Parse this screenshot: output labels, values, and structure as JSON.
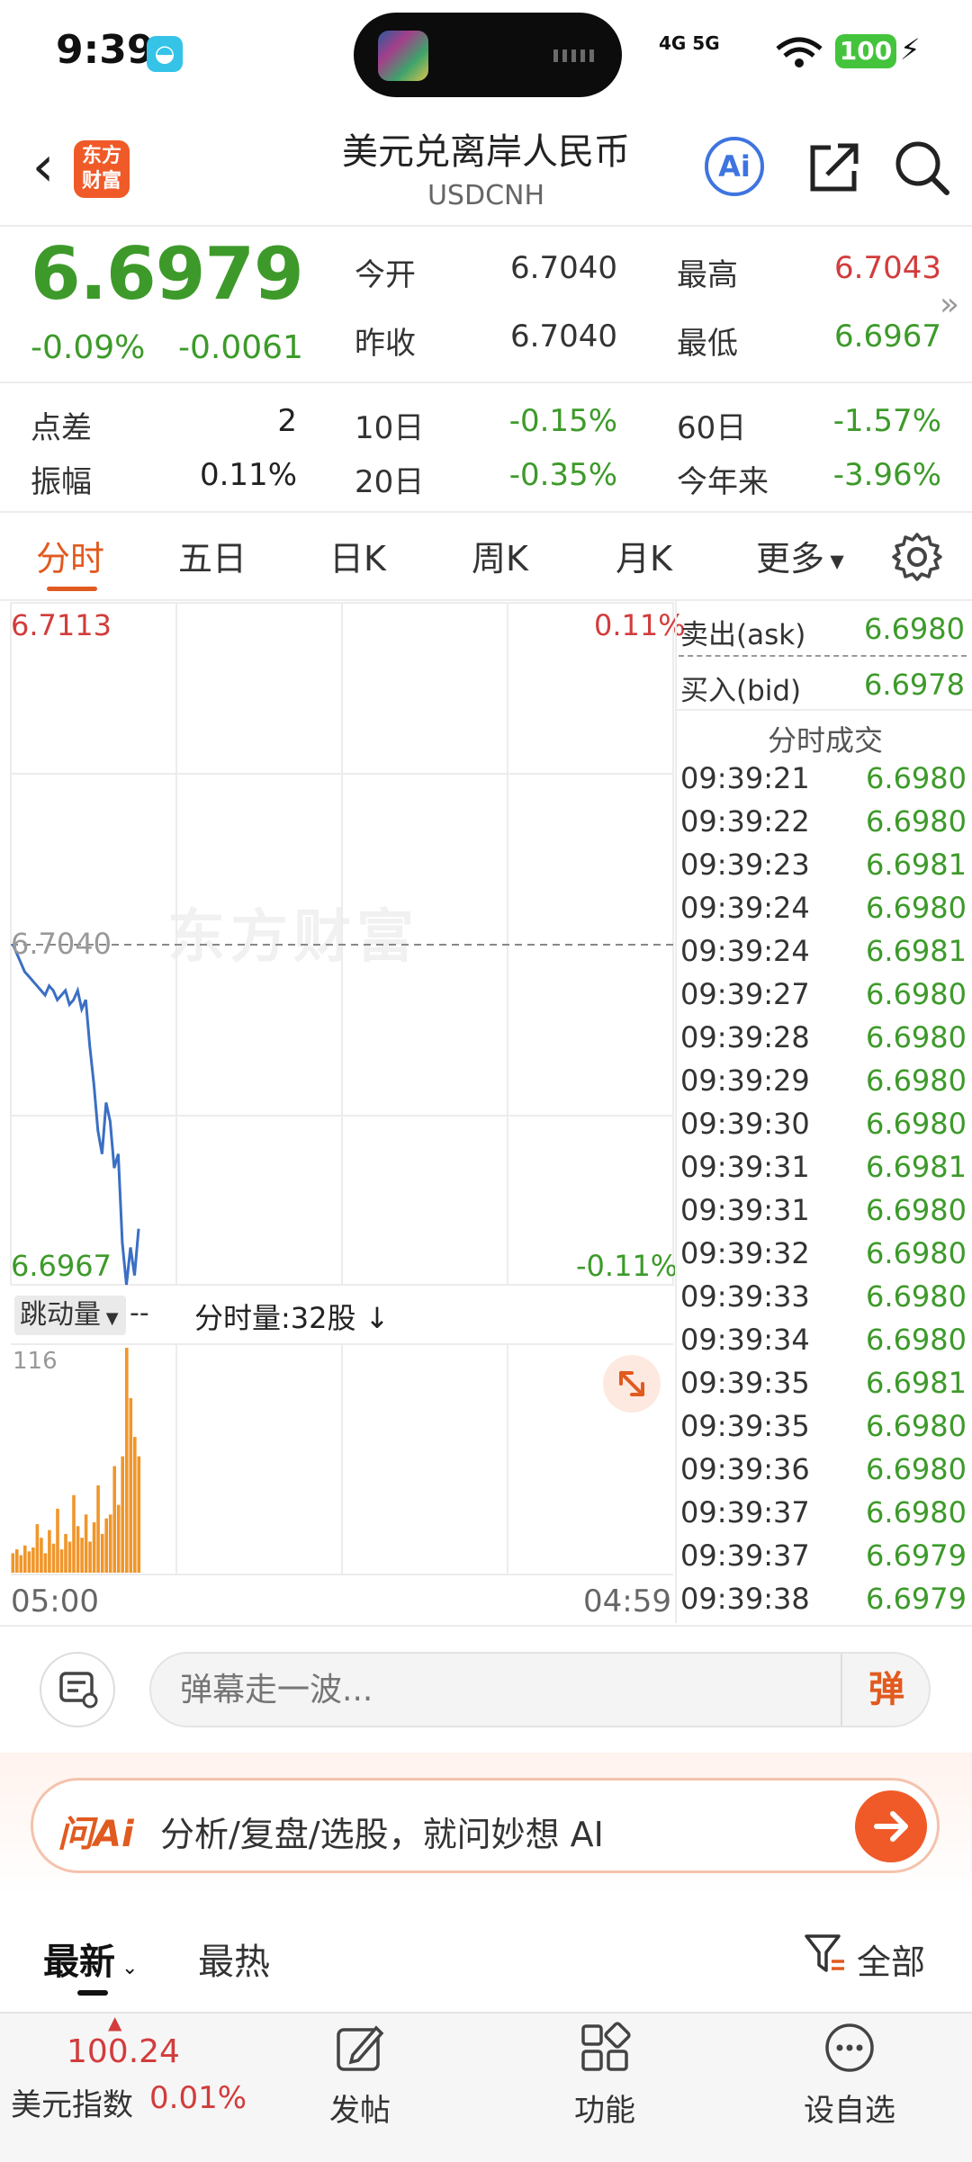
{
  "status_bar": {
    "time": "9:39",
    "network": "4G 5G",
    "battery": "100"
  },
  "header": {
    "logo_text": "东方财富",
    "title": "美元兑离岸人民币",
    "subtitle": "USDCNH",
    "ai_label": "Ai"
  },
  "quote": {
    "price": "6.6979",
    "change_pct": "-0.09%",
    "change": "-0.0061",
    "open_label": "今开",
    "open": "6.7040",
    "high_label": "最高",
    "high": "6.7043",
    "prev_close_label": "昨收",
    "prev_close": "6.7040",
    "low_label": "最低",
    "low": "6.6967",
    "spread_label": "点差",
    "spread": "2",
    "d10_label": "10日",
    "d10": "-0.15%",
    "d60_label": "60日",
    "d60": "-1.57%",
    "amplitude_label": "振幅",
    "amplitude": "0.11%",
    "d20_label": "20日",
    "d20": "-0.35%",
    "ytd_label": "今年来",
    "ytd": "-3.96%"
  },
  "tabs": [
    "分时",
    "五日",
    "日K",
    "周K",
    "月K",
    "更多"
  ],
  "chart": {
    "y_max": "6.7113",
    "y_max_pct": "0.11%",
    "y_mid": "6.7040",
    "y_min": "6.6967",
    "y_min_pct": "-0.11%",
    "watermark": "东方财富",
    "time_start": "05:00",
    "time_end": "04:59",
    "volume_select": "跳动量",
    "volume_dash": "--",
    "volume_info": "分时量:32股 ↓",
    "volume_max": "116"
  },
  "chart_data": {
    "type": "line",
    "ylim": [
      6.6967,
      6.7113
    ],
    "reference": 6.704,
    "price": [
      6.704,
      6.7038,
      6.7036,
      6.7034,
      6.7033,
      6.7032,
      6.7031,
      6.703,
      6.7029,
      6.7031,
      6.703,
      6.7028,
      6.7029,
      6.703,
      6.7027,
      6.7028,
      6.703,
      6.7026,
      6.7028,
      6.7018,
      6.701,
      6.7,
      6.6995,
      6.7006,
      6.7002,
      6.6992,
      6.6995,
      6.6976,
      6.6967,
      6.6975,
      6.6969,
      6.6979
    ],
    "volume": [
      10,
      12,
      9,
      14,
      11,
      13,
      25,
      18,
      10,
      22,
      15,
      33,
      12,
      20,
      16,
      40,
      24,
      18,
      30,
      16,
      26,
      45,
      20,
      28,
      30,
      55,
      35,
      60,
      116,
      90,
      70,
      60
    ]
  },
  "order_book": {
    "ask_label": "卖出(ask)",
    "ask": "6.6980",
    "bid_label": "买入(bid)",
    "bid": "6.6978",
    "trades_title": "分时成交",
    "trades": [
      {
        "time": "09:39:21",
        "price": "6.6980"
      },
      {
        "time": "09:39:22",
        "price": "6.6980"
      },
      {
        "time": "09:39:23",
        "price": "6.6981"
      },
      {
        "time": "09:39:24",
        "price": "6.6980"
      },
      {
        "time": "09:39:24",
        "price": "6.6981"
      },
      {
        "time": "09:39:27",
        "price": "6.6980"
      },
      {
        "time": "09:39:28",
        "price": "6.6980"
      },
      {
        "time": "09:39:29",
        "price": "6.6980"
      },
      {
        "time": "09:39:30",
        "price": "6.6980"
      },
      {
        "time": "09:39:31",
        "price": "6.6981"
      },
      {
        "time": "09:39:31",
        "price": "6.6980"
      },
      {
        "time": "09:39:32",
        "price": "6.6980"
      },
      {
        "time": "09:39:33",
        "price": "6.6980"
      },
      {
        "time": "09:39:34",
        "price": "6.6980"
      },
      {
        "time": "09:39:35",
        "price": "6.6981"
      },
      {
        "time": "09:39:35",
        "price": "6.6980"
      },
      {
        "time": "09:39:36",
        "price": "6.6980"
      },
      {
        "time": "09:39:37",
        "price": "6.6980"
      },
      {
        "time": "09:39:37",
        "price": "6.6979"
      },
      {
        "time": "09:39:38",
        "price": "6.6979"
      }
    ]
  },
  "comment_bar": {
    "placeholder": "弹幕走一波...",
    "send_label": "弹"
  },
  "ai_ask": {
    "brand": "问Ai",
    "text": "分析/复盘/选股，就问妙想 AI"
  },
  "feed": {
    "latest": "最新",
    "hot": "最热",
    "filter": "全部"
  },
  "bottom_bar": {
    "index_value": "100.24",
    "index_name": "美元指数",
    "index_pct": "0.01%",
    "post": "发帖",
    "functions": "功能",
    "watchlist": "设自选"
  },
  "colors": {
    "up": "#d23c3c",
    "down": "#3d9a2a",
    "accent": "#e15a1f",
    "price_line": "#3a6fc4",
    "volume_bar": "#f0962a"
  }
}
